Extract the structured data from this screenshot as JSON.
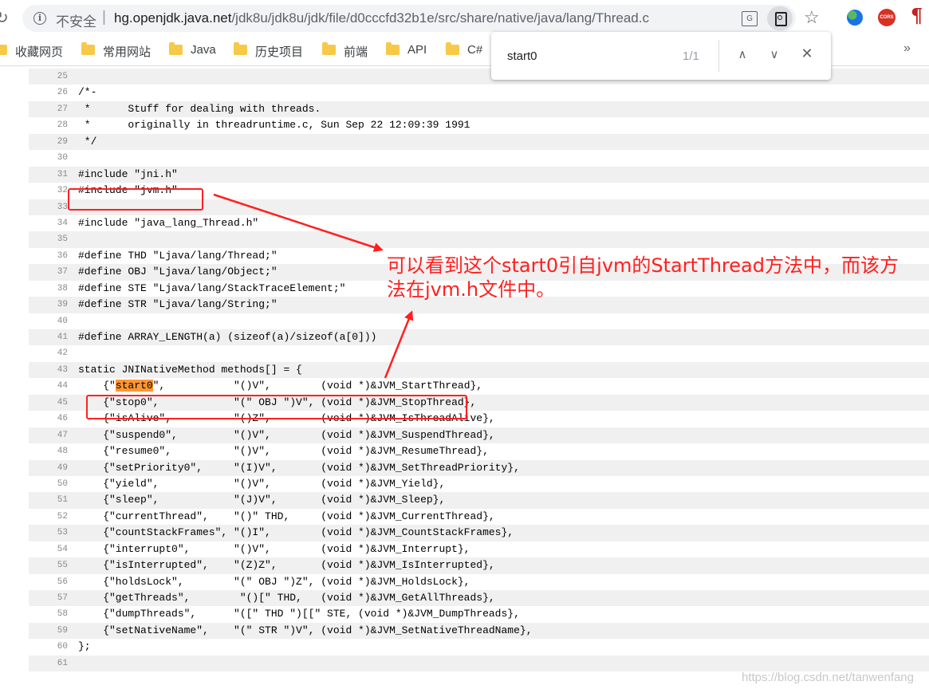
{
  "browser": {
    "insecure_label": "不安全",
    "url_host": "hg.openjdk.java.net",
    "url_path": "/jdk8u/jdk8u/jdk/file/d0cccfd32b1e/src/share/native/java/lang/Thread.c",
    "bookmarks": [
      "收藏网页",
      "常用网站",
      "Java",
      "历史项目",
      "前端",
      "API",
      "C#"
    ],
    "bookmarks_more": "»",
    "extensions": {
      "cors_label": "CORS"
    }
  },
  "find": {
    "query": "start0",
    "count": "1/1"
  },
  "code_lines": [
    {
      "n": "25",
      "text": ""
    },
    {
      "n": "26",
      "text": "/*-"
    },
    {
      "n": "27",
      "text": " *      Stuff for dealing with threads."
    },
    {
      "n": "28",
      "text": " *      originally in threadruntime.c, Sun Sep 22 12:09:39 1991"
    },
    {
      "n": "29",
      "text": " */"
    },
    {
      "n": "30",
      "text": ""
    },
    {
      "n": "31",
      "text": "#include \"jni.h\""
    },
    {
      "n": "32",
      "text": "#include \"jvm.h\""
    },
    {
      "n": "33",
      "text": ""
    },
    {
      "n": "34",
      "text": "#include \"java_lang_Thread.h\""
    },
    {
      "n": "35",
      "text": ""
    },
    {
      "n": "36",
      "text": "#define THD \"Ljava/lang/Thread;\""
    },
    {
      "n": "37",
      "text": "#define OBJ \"Ljava/lang/Object;\""
    },
    {
      "n": "38",
      "text": "#define STE \"Ljava/lang/StackTraceElement;\""
    },
    {
      "n": "39",
      "text": "#define STR \"Ljava/lang/String;\""
    },
    {
      "n": "40",
      "text": ""
    },
    {
      "n": "41",
      "text": "#define ARRAY_LENGTH(a) (sizeof(a)/sizeof(a[0]))"
    },
    {
      "n": "42",
      "text": ""
    },
    {
      "n": "43",
      "text": "static JNINativeMethod methods[] = {"
    },
    {
      "n": "44",
      "pre": "    {\"",
      "hl": "start0",
      "text": "\",           \"()V\",        (void *)&JVM_StartThread},"
    },
    {
      "n": "45",
      "text": "    {\"stop0\",            \"(\" OBJ \")V\", (void *)&JVM_StopThread},"
    },
    {
      "n": "46",
      "text": "    {\"isAlive\",          \"()Z\",        (void *)&JVM_IsThreadAlive},"
    },
    {
      "n": "47",
      "text": "    {\"suspend0\",         \"()V\",        (void *)&JVM_SuspendThread},"
    },
    {
      "n": "48",
      "text": "    {\"resume0\",          \"()V\",        (void *)&JVM_ResumeThread},"
    },
    {
      "n": "49",
      "text": "    {\"setPriority0\",     \"(I)V\",       (void *)&JVM_SetThreadPriority},"
    },
    {
      "n": "50",
      "text": "    {\"yield\",            \"()V\",        (void *)&JVM_Yield},"
    },
    {
      "n": "51",
      "text": "    {\"sleep\",            \"(J)V\",       (void *)&JVM_Sleep},"
    },
    {
      "n": "52",
      "text": "    {\"currentThread\",    \"()\" THD,     (void *)&JVM_CurrentThread},"
    },
    {
      "n": "53",
      "text": "    {\"countStackFrames\", \"()I\",        (void *)&JVM_CountStackFrames},"
    },
    {
      "n": "54",
      "text": "    {\"interrupt0\",       \"()V\",        (void *)&JVM_Interrupt},"
    },
    {
      "n": "55",
      "text": "    {\"isInterrupted\",    \"(Z)Z\",       (void *)&JVM_IsInterrupted},"
    },
    {
      "n": "56",
      "text": "    {\"holdsLock\",        \"(\" OBJ \")Z\", (void *)&JVM_HoldsLock},"
    },
    {
      "n": "57",
      "text": "    {\"getThreads\",        \"()[\" THD,   (void *)&JVM_GetAllThreads},"
    },
    {
      "n": "58",
      "text": "    {\"dumpThreads\",      \"([\" THD \")[[\" STE, (void *)&JVM_DumpThreads},"
    },
    {
      "n": "59",
      "text": "    {\"setNativeName\",    \"(\" STR \")V\", (void *)&JVM_SetNativeThreadName},"
    },
    {
      "n": "60",
      "text": "};"
    },
    {
      "n": "61",
      "text": ""
    }
  ],
  "annotation": "可以看到这个start0引自jvm的StartThread方法中，而该方法在jvm.h文件中。",
  "watermark": "https://blog.csdn.net/tanwenfang",
  "colors": {
    "annotation": "#ff2020",
    "find_highlight": "#ff9632"
  }
}
